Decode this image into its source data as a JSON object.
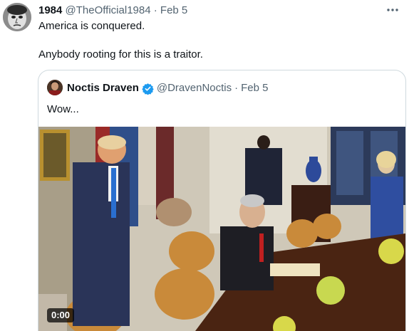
{
  "tweet": {
    "display_name": "1984",
    "handle": "@TheOfficial1984",
    "separator": "·",
    "date": "Feb 5",
    "more_icon": "more-horizontal-icon",
    "text_line1": "America is conquered.",
    "text_line2": "Anybody rooting for this is a traitor."
  },
  "quote": {
    "display_name": "Noctis Draven",
    "verified_icon": "verified-badge-icon",
    "handle": "@DravenNoctis",
    "separator": "·",
    "date": "Feb 5",
    "text": "Wow...",
    "video": {
      "duration": "0:00",
      "accent_color": "#1d9bf0"
    }
  }
}
